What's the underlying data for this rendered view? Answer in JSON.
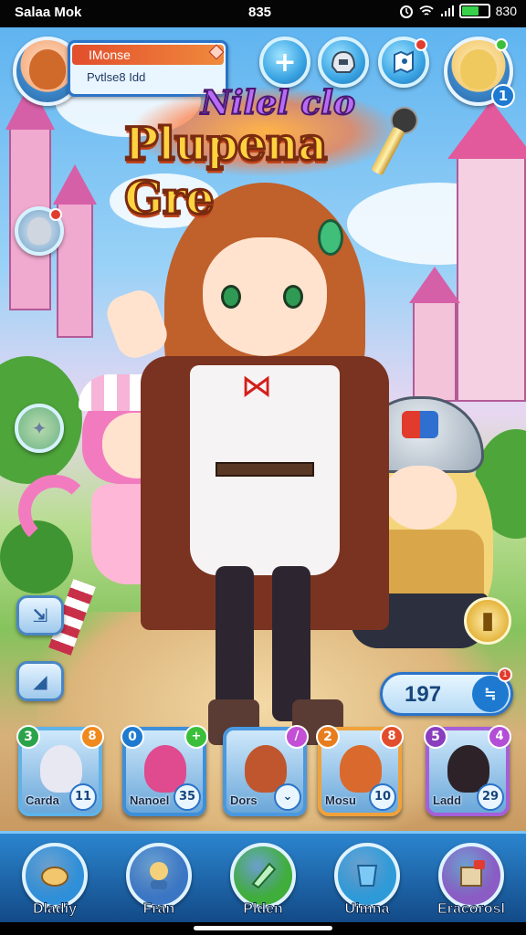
{
  "status_bar": {
    "carrier": "Salaa Mok",
    "time": "835",
    "battery_text": "830",
    "battery_level": 0.65
  },
  "player": {
    "name": "IMonse",
    "subtitle": "Pvtlse8 Idd"
  },
  "hud_buttons": {
    "add_icon": "plus-icon",
    "helmet_icon": "helmet-icon",
    "map_icon": "map-icon",
    "friend_badge": "1"
  },
  "title": {
    "line1": "Nilel clo",
    "line2": "Plupena Gre"
  },
  "counter": {
    "value": "197",
    "badge": "1"
  },
  "cards": [
    {
      "level": "3",
      "corner": "8",
      "name": "Carda",
      "number": "11",
      "level_color": "#2aa34a",
      "corner_color": "#f08a1e",
      "frame_color": "#5fb3e8",
      "portrait_color": "#e8e8f2"
    },
    {
      "level": "0",
      "corner": "+",
      "name": "Nanoel",
      "number": "35",
      "level_color": "#1e7ad0",
      "corner_color": "#3bbf3a",
      "frame_color": "#3f8fd8",
      "portrait_color": "#e04a8e"
    },
    {
      "level": "",
      "corner": "/",
      "name": "Dors",
      "number": "⌄",
      "level_color": "#1e7ad0",
      "corner_color": "#c24fd6",
      "frame_color": "#4a98df",
      "portrait_color": "#c0562e"
    },
    {
      "level": "2",
      "corner": "8",
      "name": "Mosu",
      "number": "10",
      "level_color": "#e87d1e",
      "corner_color": "#e24e2c",
      "frame_color": "#f0a23a",
      "portrait_color": "#d9692c"
    },
    {
      "level": "5",
      "corner": "4",
      "name": "Ladd",
      "number": "29",
      "level_color": "#8a3dbf",
      "corner_color": "#b24fd6",
      "frame_color": "#a55fd8",
      "portrait_color": "#2d2228"
    }
  ],
  "bottom_nav": [
    {
      "label": "Dladiy",
      "icon": "bread-icon",
      "color": "#2f8fd8"
    },
    {
      "label": "Fran",
      "icon": "friend-icon",
      "color": "#3b76c4"
    },
    {
      "label": "Plden",
      "icon": "pen-icon",
      "color": "#3fae3a"
    },
    {
      "label": "Uimna",
      "icon": "bucket-icon",
      "color": "#2e9ad8"
    },
    {
      "label": "Eracorosl",
      "icon": "gift-box-icon",
      "color": "#8a5cc4"
    }
  ]
}
